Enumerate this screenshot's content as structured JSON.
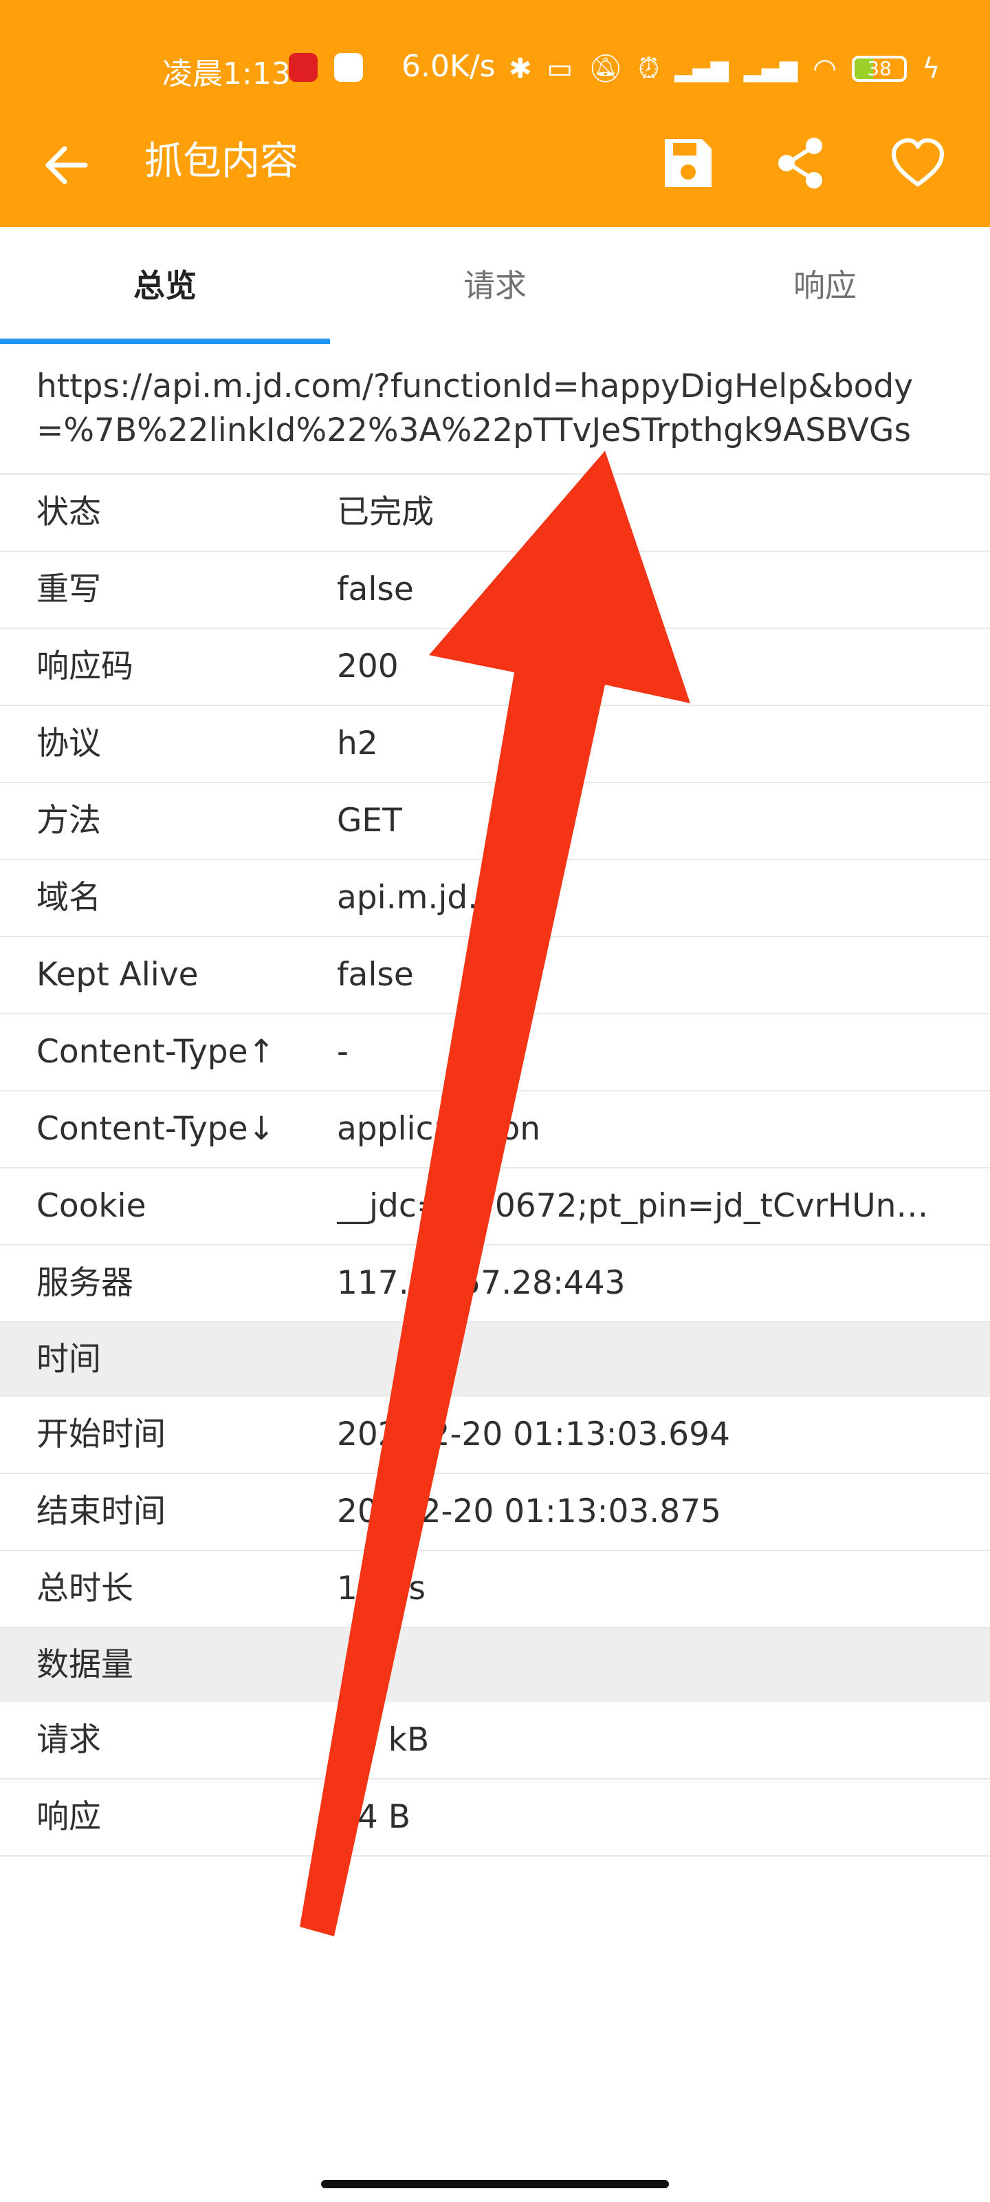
{
  "status_bar": {
    "time": "凌晨1:13",
    "net_speed": "6.0K/s",
    "battery_level": "38",
    "icons": [
      "netease-music-icon",
      "chat-app-icon",
      "bluetooth-icon",
      "vibrate-icon",
      "mute-icon",
      "alarm-icon",
      "signal-hd-1-icon",
      "signal-hd-2-icon",
      "wifi-icon",
      "battery-icon",
      "charging-icon"
    ]
  },
  "toolbar": {
    "title": "抓包内容",
    "back_icon": "arrow-back-icon",
    "save_icon": "save-icon",
    "share_icon": "share-icon",
    "favorite_icon": "heart-icon"
  },
  "tabs": [
    "总览",
    "请求",
    "响应"
  ],
  "active_tab": "总览",
  "url": "https://api.m.jd.com/?functionId=happyDigHelp&body=%7B%22linkId%22%3A%22pTTvJeSTrpthgk9ASBVGsw%…",
  "overview_rows": [
    {
      "key": "状态",
      "value": "已完成"
    },
    {
      "key": "重写",
      "value": "false"
    },
    {
      "key": "响应码",
      "value": "200"
    },
    {
      "key": "协议",
      "value": "h2"
    },
    {
      "key": "方法",
      "value": "GET"
    },
    {
      "key": "域名",
      "value": "api.m.jd.c"
    },
    {
      "key": "Kept Alive",
      "value": "false"
    },
    {
      "key": "Content-Type↑",
      "value": "-"
    },
    {
      "key": "Content-Type↓",
      "value": "applica      /json"
    },
    {
      "key": "Cookie",
      "value": "__jdc=     270672;pt_pin=jd_tCvrHUn…"
    },
    {
      "key": "服务器",
      "value": "117.15     57.28:443"
    }
  ],
  "time_section": {
    "label": "时间",
    "rows": [
      {
        "key": "开始时间",
        "value": "202   02-20 01:13:03.694"
      },
      {
        "key": "结束时间",
        "value": "20     -02-20 01:13:03.875"
      },
      {
        "key": "总时长",
        "value": "18     ns"
      }
    ]
  },
  "data_section": {
    "label": "数据量",
    "rows": [
      {
        "key": "请求",
        "value": "   06 kB"
      },
      {
        "key": "响应",
        "value": "   34 B"
      }
    ]
  },
  "colors": {
    "appbar": "#ffa00b",
    "tab_indicator": "#2196f3",
    "arrow": "#f53315",
    "section_bg": "#eeeeee"
  }
}
